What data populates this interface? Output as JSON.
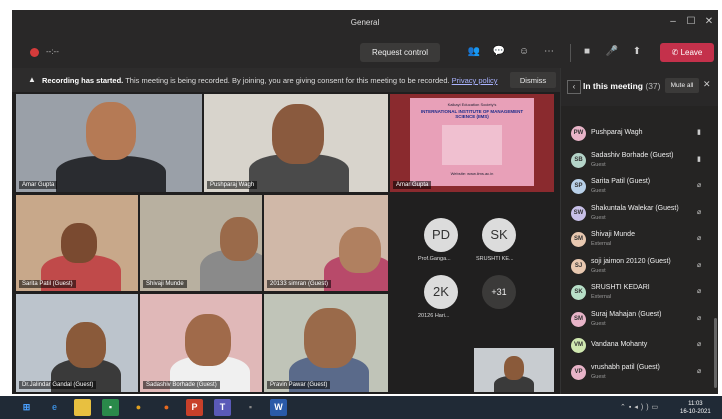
{
  "window": {
    "title": "General"
  },
  "toolbar": {
    "timer": "--:--",
    "request_control": "Request control",
    "leave": "Leave"
  },
  "banner": {
    "bold": "Recording has started.",
    "text": " This meeting is being recorded. By joining, you are giving consent for this meeting to be recorded. ",
    "link": "Privacy policy",
    "dismiss": "Dismiss"
  },
  "tiles": [
    {
      "name": "Amar Gupta"
    },
    {
      "name": "Pushparaj Wagh"
    },
    {
      "name": "Amar Gupta"
    },
    {
      "name": "Sarita Patil (Guest)"
    },
    {
      "name": "Shivaji Munde"
    },
    {
      "name": "20133 simran (Guest)"
    },
    {
      "name": "Dr.Jalindar Gandal (Guest)"
    },
    {
      "name": "Sadashiv Borhade (Guest)"
    },
    {
      "name": "Pravin Pawar (Guest)"
    }
  ],
  "avatars": [
    {
      "initials": "PD",
      "label": "Prof.Ganga..."
    },
    {
      "initials": "SK",
      "label": "SRUSHTI KE..."
    },
    {
      "initials": "2K",
      "label": "20126 Hari..."
    },
    {
      "initials": "+31",
      "label": ""
    }
  ],
  "panel": {
    "title": "In this meeting",
    "count": "(37)",
    "mute_all": "Mute all",
    "participants": [
      {
        "initials": "PW",
        "name": "Pushparaj Wagh",
        "role": "",
        "color": "#e8b4c8"
      },
      {
        "initials": "SB",
        "name": "Sadashiv Borhade (Guest)",
        "role": "Guest",
        "color": "#b4d4c8"
      },
      {
        "initials": "SP",
        "name": "Sarita Patil (Guest)",
        "role": "Guest",
        "color": "#b8d0e8"
      },
      {
        "initials": "SW",
        "name": "Shakuntala Walekar (Guest)",
        "role": "Guest",
        "color": "#c8c0e8"
      },
      {
        "initials": "SM",
        "name": "Shivaji Munde",
        "role": "External",
        "color": "#e8c8b0"
      },
      {
        "initials": "SJ",
        "name": "soji jaimon 20120 (Guest)",
        "role": "Guest",
        "color": "#e8c8b0"
      },
      {
        "initials": "SK",
        "name": "SRUSHTI KEDARI",
        "role": "External",
        "color": "#b8e0c8"
      },
      {
        "initials": "SM",
        "name": "Suraj Mahajan (Guest)",
        "role": "Guest",
        "color": "#e8b4c8"
      },
      {
        "initials": "VM",
        "name": "Vandana Mohanty",
        "role": "",
        "color": "#d0e8b0"
      },
      {
        "initials": "VP",
        "name": "vrushabh patil (Guest)",
        "role": "Guest",
        "color": "#e8b4c8"
      }
    ]
  },
  "slide": {
    "line1": "Kaikayi Education Society's",
    "line2": "INTERNATIONAL INSTITUTE OF MANAGEMENT SCIENCE (IIMS)",
    "line3": "Website: www.iims.ac.in"
  },
  "taskbar": {
    "time": "11:03",
    "date": "16-10-2021"
  }
}
